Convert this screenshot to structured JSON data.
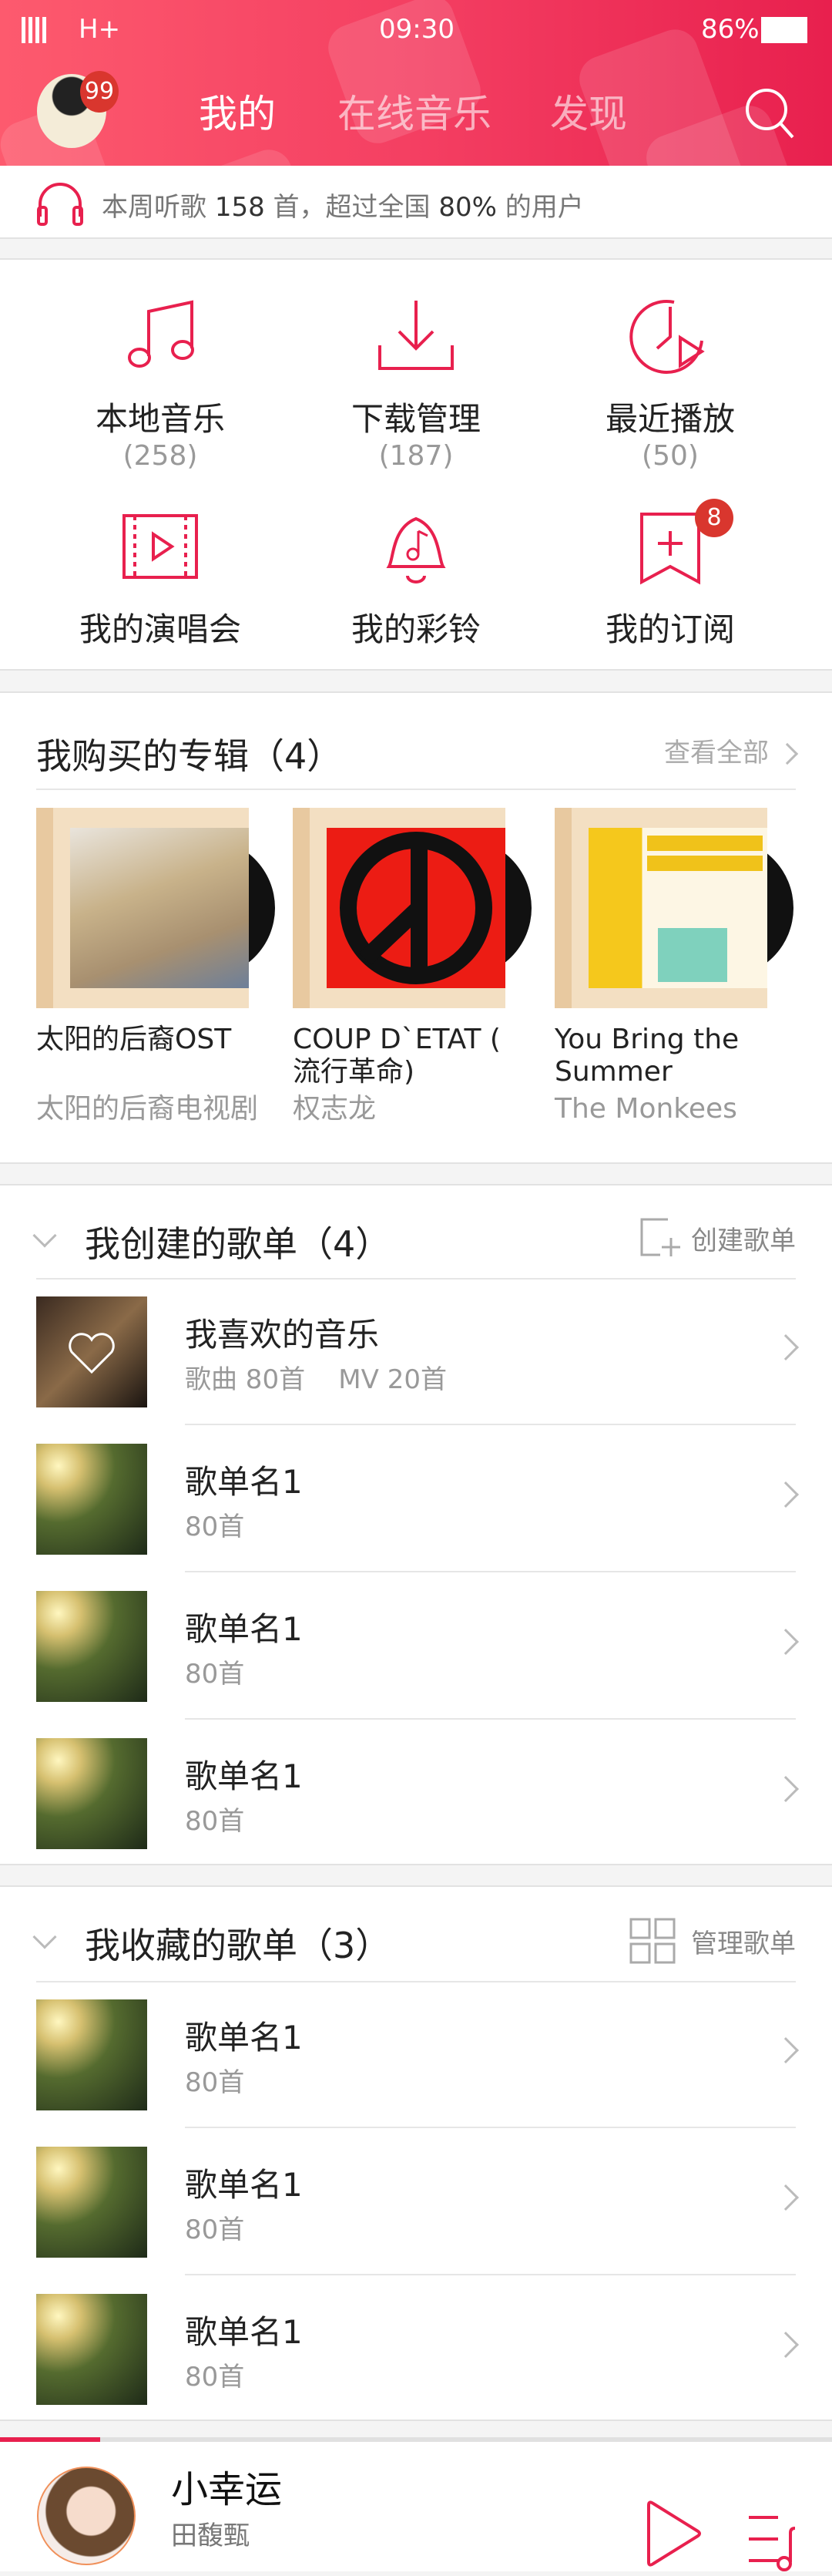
{
  "status": {
    "network": "H+",
    "time": "09:30",
    "battery": "86%"
  },
  "header": {
    "badge": "99",
    "tabs": [
      "我的",
      "在线音乐",
      "发现"
    ],
    "active_tab": 0,
    "search_icon": "search-icon"
  },
  "stat": {
    "text_pre": "本周听歌 ",
    "count": "158",
    "text_mid": " 首，超过全国 ",
    "percent": "80%",
    "text_post": " 的用户"
  },
  "grid": [
    {
      "label": "本地音乐",
      "count": "(258)",
      "icon": "music-note-icon"
    },
    {
      "label": "下载管理",
      "count": "(187)",
      "icon": "download-icon"
    },
    {
      "label": "最近播放",
      "count": "(50)",
      "icon": "recent-play-icon"
    },
    {
      "label": "我的演唱会",
      "icon": "concert-video-icon"
    },
    {
      "label": "我的彩铃",
      "icon": "ringtone-bell-icon"
    },
    {
      "label": "我的订阅",
      "icon": "subscribe-bookmark-icon",
      "badge": "8"
    }
  ],
  "albums": {
    "title": "我购买的专辑（4）",
    "view_all": "查看全部",
    "items": [
      {
        "title": "太阳的后裔OST",
        "subtitle": "太阳的后裔电视剧"
      },
      {
        "title": "COUP D`ETAT ( 流行革命)",
        "subtitle": "权志龙"
      },
      {
        "title": "You Bring the Summer",
        "subtitle": " The Monkees"
      }
    ]
  },
  "created": {
    "title": "我创建的歌单（4）",
    "action": "创建歌单",
    "items": [
      {
        "name": "我喜欢的音乐",
        "meta": "歌曲 80首    MV 20首"
      },
      {
        "name": "歌单名1",
        "meta": "80首"
      },
      {
        "name": "歌单名1",
        "meta": "80首"
      },
      {
        "name": "歌单名1",
        "meta": "80首"
      }
    ]
  },
  "collected": {
    "title": "我收藏的歌单（3）",
    "action": "管理歌单",
    "items": [
      {
        "name": "歌单名1",
        "meta": "80首"
      },
      {
        "name": "歌单名1",
        "meta": "80首"
      },
      {
        "name": "歌单名1",
        "meta": "80首"
      }
    ]
  },
  "player": {
    "song": "小幸运",
    "artist": "田馥甄",
    "progress": 0.12
  },
  "colors": {
    "accent": "#e8204e",
    "header_start": "#fd5a6e",
    "header_end": "#e8204e"
  }
}
